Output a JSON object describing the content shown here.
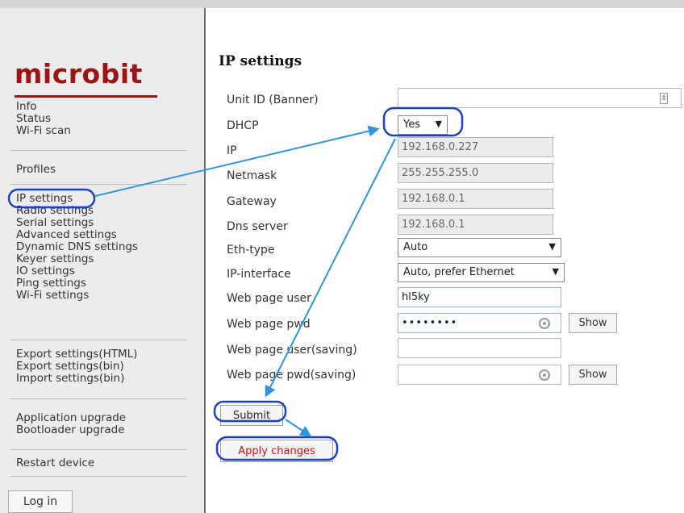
{
  "brand": {
    "logo": "microbit",
    "logo_color": "#9b1515"
  },
  "sidebar": {
    "group1": [
      "Info",
      "Status",
      "Wi-Fi scan"
    ],
    "group2": [
      "Profiles"
    ],
    "group3": [
      "IP settings",
      "Radio settings",
      "Serial settings",
      "Advanced settings",
      "Dynamic DNS settings",
      "Keyer settings",
      "IO settings",
      "Ping settings",
      "Wi-Fi settings"
    ],
    "group4": [
      "Export settings(HTML)",
      "Export settings(bin)",
      "Import settings(bin)"
    ],
    "group5": [
      "Application upgrade",
      "Bootloader upgrade"
    ],
    "group6": [
      "Restart device"
    ],
    "login_label": "Log in"
  },
  "form": {
    "title": "IP settings",
    "unit_id": {
      "label": "Unit ID (Banner)",
      "value": ""
    },
    "dhcp": {
      "label": "DHCP",
      "value": "Yes"
    },
    "ip": {
      "label": "IP",
      "value": "192.168.0.227"
    },
    "netmask": {
      "label": "Netmask",
      "value": "255.255.255.0"
    },
    "gateway": {
      "label": "Gateway",
      "value": "192.168.0.1"
    },
    "dns": {
      "label": "Dns server",
      "value": "192.168.0.1"
    },
    "eth_type": {
      "label": "Eth-type",
      "value": "Auto"
    },
    "ip_interface": {
      "label": "IP-interface",
      "value": "Auto, prefer Ethernet"
    },
    "web_user": {
      "label": "Web page user",
      "value": "hl5ky"
    },
    "web_pwd": {
      "label": "Web page pwd",
      "value": "••••••••",
      "show_label": "Show"
    },
    "web_user_saving": {
      "label": "Web page user(saving)",
      "value": ""
    },
    "web_pwd_saving": {
      "label": "Web page pwd(saving)",
      "value": "",
      "show_label": "Show"
    },
    "submit_label": "Submit",
    "apply_label": "Apply changes"
  },
  "annotation_color": "#1d3fc2",
  "arrow_color": "#2f95e0"
}
